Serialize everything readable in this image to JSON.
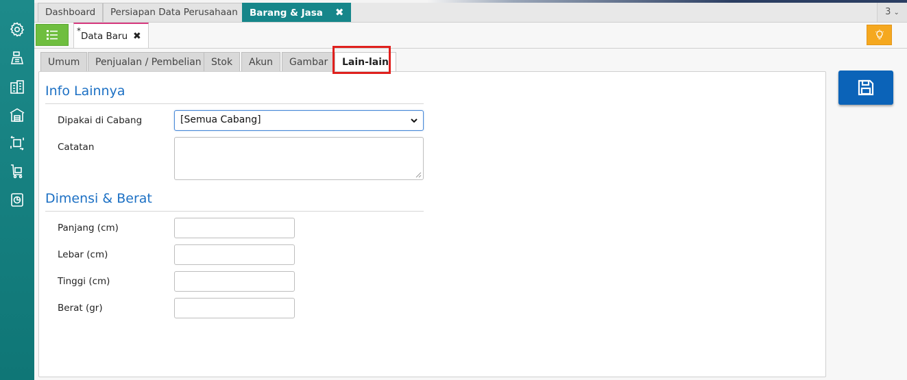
{
  "module_tabs": [
    {
      "label": "Dashboard"
    },
    {
      "label": "Persiapan Data Perusahaan"
    },
    {
      "label": "Barang & Jasa"
    }
  ],
  "tab_close_glyph": "✖",
  "tab_counter": "3",
  "doc_tab": {
    "modified_mark": "*",
    "label": "Data Baru",
    "close_glyph": "✖"
  },
  "sub_tabs": [
    {
      "label": "Umum"
    },
    {
      "label": "Penjualan / Pembelian"
    },
    {
      "label": "Stok"
    },
    {
      "label": "Akun"
    },
    {
      "label": "Gambar"
    },
    {
      "label": "Lain-lain"
    }
  ],
  "sections": {
    "info": {
      "title": "Info Lainnya",
      "branch_label": "Dipakai di Cabang",
      "branch_value": "[Semua Cabang]",
      "notes_label": "Catatan"
    },
    "dimension": {
      "title": "Dimensi & Berat",
      "length_label": "Panjang (cm)",
      "width_label": "Lebar (cm)",
      "height_label": "Tinggi (cm)",
      "weight_label": "Berat (gr)"
    }
  },
  "colors": {
    "accent_teal": "#16868a",
    "menu_green": "#6fbe3f",
    "hint_orange": "#f5a81f",
    "save_blue": "#0b63b8",
    "section_blue": "#1c70c4",
    "highlight_red": "#e0201d"
  },
  "icons": {
    "sidebar": [
      "gear-icon",
      "cashier-icon",
      "building-icon",
      "warehouse-icon",
      "box-transfer-icon",
      "cart-icon",
      "report-chart-icon"
    ],
    "menu": "list-icon",
    "hint": "lightbulb-icon",
    "save": "save-icon"
  }
}
